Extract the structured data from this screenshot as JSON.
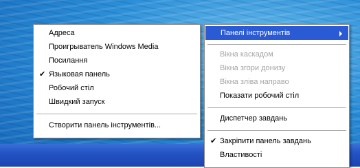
{
  "context_menu": {
    "items": [
      {
        "label": "Адреса",
        "checked": false
      },
      {
        "label": "Проигрыватель Windows Media",
        "checked": false
      },
      {
        "label": "Посилання",
        "checked": false
      },
      {
        "label": "Языковая панель",
        "checked": true
      },
      {
        "label": "Робочий стіл",
        "checked": false
      },
      {
        "label": "Швидкий запуск",
        "checked": false
      },
      {
        "label": "Створити панель інструментів...",
        "checked": false
      }
    ]
  },
  "taskbar_menu": {
    "items": [
      {
        "label": "Панелі інструментів",
        "submenu": true,
        "highlighted": true
      },
      {
        "label": "Вікна каскадом",
        "disabled": true
      },
      {
        "label": "Вікна згори донизу",
        "disabled": true
      },
      {
        "label": "Вікна зліва направо",
        "disabled": true
      },
      {
        "label": "Показати робочий стіл",
        "disabled": false
      },
      {
        "label": "Диспетчер завдань",
        "disabled": false
      },
      {
        "label": "Закріпити панель завдань",
        "checked": true
      },
      {
        "label": "Властивості",
        "disabled": false
      }
    ]
  },
  "check_glyph": "✔",
  "colors": {
    "highlight": "#2a5ad4",
    "disabled_text": "#a4a4a4",
    "taskbar": "#2353c4"
  }
}
